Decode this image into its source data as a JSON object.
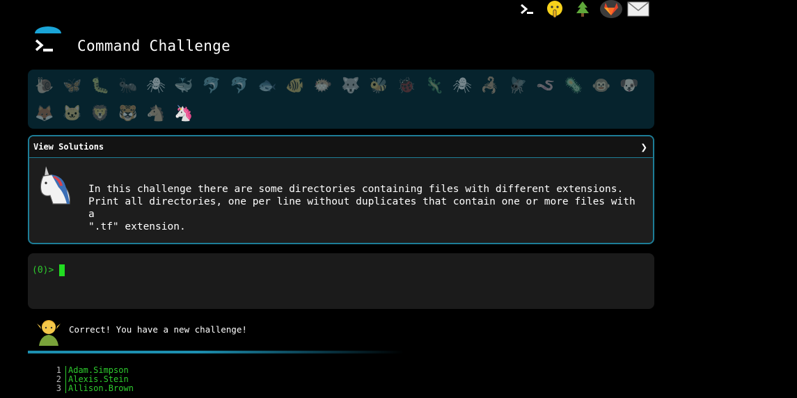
{
  "header": {
    "title": "Command Challenge",
    "top_icons": [
      "terminal-icon",
      "shushing-face-icon",
      "tree-icon",
      "gitlab-icon",
      "mail-icon"
    ]
  },
  "animals": {
    "row1": [
      "🐌",
      "🦋",
      "🐛",
      "🐜",
      "🕷",
      "🐳",
      "🐬",
      "🐬",
      "🐟",
      "🐠",
      "🐡",
      "🐺",
      "🐝",
      "🐞",
      "🦎",
      "🕷",
      "🦂",
      "🪰",
      "🪱",
      "🦠",
      "🐵",
      "🐶"
    ],
    "row2": [
      "🦊",
      "🐱",
      "🦁",
      "🐯",
      "🐴",
      "🦄"
    ],
    "current": "🦄"
  },
  "challenge": {
    "header_label": "View Solutions",
    "chevron": "❯",
    "description": "In this challenge there are some directories containing files with different extensions.\nPrint all directories, one per line without duplicates that contain one or more files with a\n\".tf\" extension."
  },
  "terminal": {
    "prompt": "(0)>"
  },
  "feedback": {
    "message": "Correct! You have a new challenge!"
  },
  "output": {
    "lines": [
      {
        "num": "1",
        "text": "Adam.Simpson"
      },
      {
        "num": "2",
        "text": "Alexis.Stein"
      },
      {
        "num": "3",
        "text": "Allison.Brown"
      }
    ]
  },
  "colors": {
    "accent": "#1d7d97",
    "terminal_green": "#2ecc2e",
    "strip_bg": "#06232d"
  }
}
